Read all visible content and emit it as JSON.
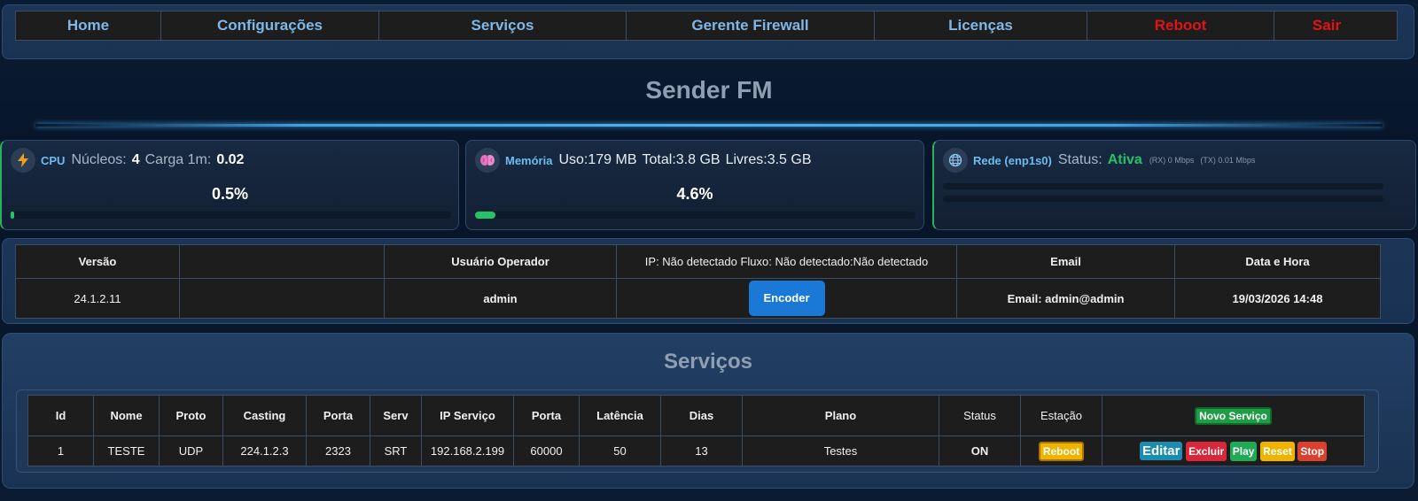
{
  "nav": {
    "items": [
      {
        "label": "Home",
        "color": "#7fb7e6"
      },
      {
        "label": "Configurações",
        "color": "#7fb7e6"
      },
      {
        "label": "Serviços",
        "color": "#7fb7e6"
      },
      {
        "label": "Gerente Firewall",
        "color": "#7fb7e6"
      },
      {
        "label": "Licenças",
        "color": "#7fb7e6"
      },
      {
        "label": "Reboot",
        "color": "#e01414"
      },
      {
        "label": "Sair",
        "color": "#e01414"
      }
    ]
  },
  "page": {
    "title": "Sender FM"
  },
  "cpu": {
    "icon": "lightning-icon",
    "label": "CPU",
    "cores_label": "Núcleos:",
    "cores": "4",
    "load_label": "Carga 1m:",
    "load": "0.02",
    "percent": "0.5%",
    "bar_fraction": 0.005
  },
  "memory": {
    "icon": "brain-icon",
    "label": "Memória",
    "usage": "Uso:179 MB",
    "total": "Total:3.8 GB",
    "free": "Livres:3.5 GB",
    "percent": "4.6%",
    "bar_fraction": 0.046
  },
  "network": {
    "icon": "globe-icon",
    "label": "Rede (enp1s0)",
    "status_label": "Status:",
    "status": "Ativa",
    "rx": "(RX) 0 Mbps",
    "tx": "(TX) 0.01 Mbps"
  },
  "info": {
    "headers": [
      "Versão",
      "",
      "Usuário Operador",
      "IP: Não detectado Fluxo: Não detectado:Não detectado",
      "Email",
      "Data e Hora"
    ],
    "version": "24.1.2.11",
    "blank": "",
    "user": "admin",
    "encoder_button": "Encoder",
    "email": "Email: admin@admin",
    "datetime": "19/03/2026 14:48"
  },
  "services": {
    "title": "Serviços",
    "headers": [
      "Id",
      "Nome",
      "Proto",
      "Casting",
      "Porta",
      "Serv",
      "IP Serviço",
      "Porta",
      "Latência",
      "Dias",
      "Plano",
      "Status",
      "Estação"
    ],
    "new_button": "Novo Serviço",
    "rows": [
      {
        "id": "1",
        "nome": "TESTE",
        "proto": "UDP",
        "casting": "224.1.2.3",
        "porta": "2323",
        "serv": "SRT",
        "ip": "192.168.2.199",
        "porta2": "60000",
        "latencia": "50",
        "dias": "13",
        "plano": "Testes",
        "status": "ON",
        "estacao_button": "Reboot",
        "actions": {
          "edit": "Editar",
          "delete": "Excluir",
          "play": "Play",
          "reset": "Reset",
          "stop": "Stop"
        }
      }
    ]
  },
  "colors": {
    "accent": "#6dbcf0",
    "danger": "#e01414",
    "success": "#27c167",
    "encoder": "#1a78d6"
  }
}
